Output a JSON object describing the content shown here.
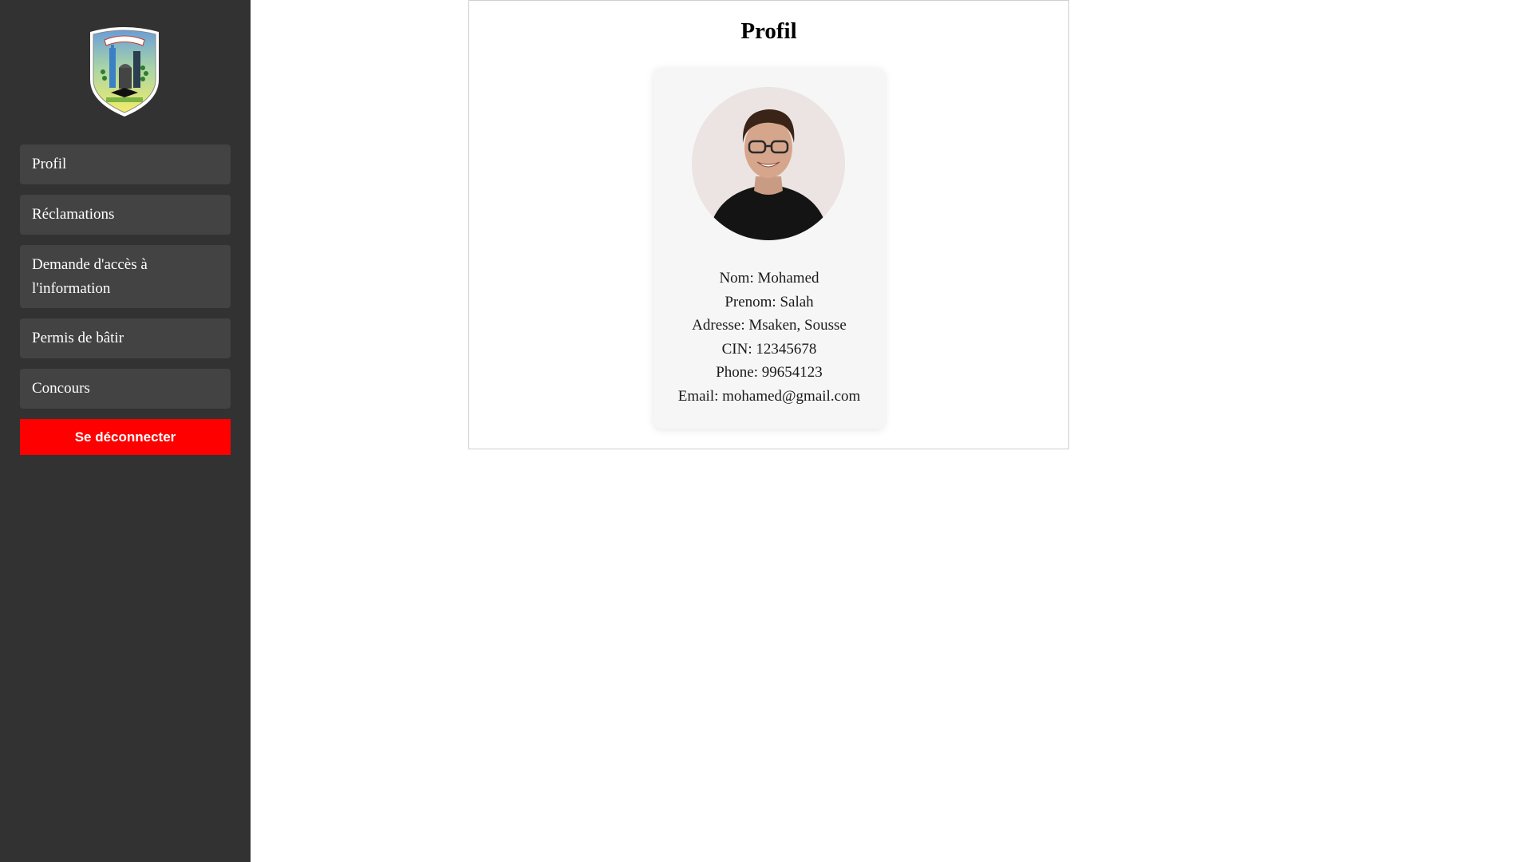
{
  "sidebar": {
    "nav_items": [
      {
        "label": "Profil"
      },
      {
        "label": "Réclamations"
      },
      {
        "label": "Demande d'accès à l'information"
      },
      {
        "label": "Permis de bâtir"
      },
      {
        "label": "Concours"
      }
    ],
    "logout_label": "Se déconnecter"
  },
  "main": {
    "title": "Profil",
    "profile": {
      "nom_label": "Nom:",
      "nom": "Mohamed",
      "prenom_label": "Prenom:",
      "prenom": "Salah",
      "adresse_label": "Adresse:",
      "adresse": "Msaken, Sousse",
      "cin_label": "CIN:",
      "cin": "12345678",
      "phone_label": "Phone:",
      "phone": "99654123",
      "email_label": "Email:",
      "email": "mohamed@gmail.com"
    }
  },
  "colors": {
    "sidebar_bg": "#323232",
    "nav_item_bg": "#434343",
    "logout_bg": "#ff0000",
    "card_bg": "#f7f6f6"
  }
}
